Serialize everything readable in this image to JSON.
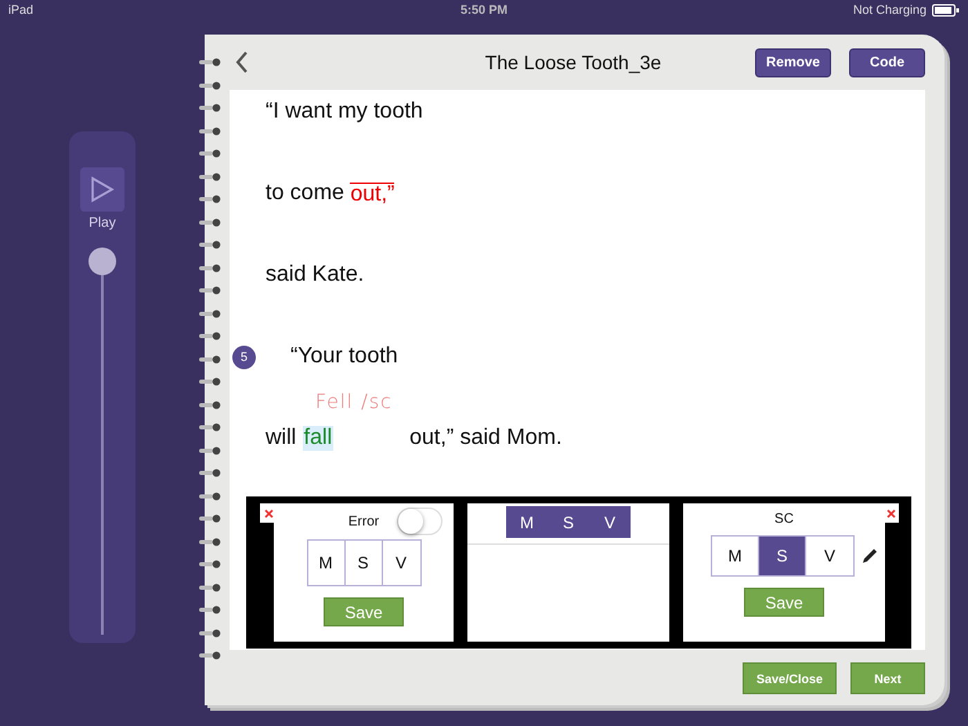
{
  "status_bar": {
    "device": "iPad",
    "time": "5:50 PM",
    "battery": "Not Charging"
  },
  "player": {
    "play_label": "Play",
    "slider": {
      "level": 1
    }
  },
  "header": {
    "title": "The Loose Tooth_3e",
    "buttons": [
      "Remove",
      "Code"
    ]
  },
  "story": [
    {
      "segments": [
        {
          "kind": "plain",
          "text": "“I want my tooth"
        }
      ]
    },
    {
      "segments": [
        {
          "kind": "plain",
          "text": "to come "
        },
        {
          "kind": "error",
          "text": "out,”"
        }
      ]
    },
    {
      "segments": [
        {
          "kind": "plain",
          "text": "said Kate."
        }
      ]
    },
    {
      "badge": "5",
      "segments": [
        {
          "kind": "plain",
          "text": "“Your tooth"
        }
      ]
    },
    {
      "segments": [
        {
          "kind": "plain",
          "text": "will "
        },
        {
          "kind": "self_corrected",
          "text": "fall",
          "note": "Fell /sc"
        },
        {
          "kind": "plain",
          "text": "out,” said Mom."
        }
      ]
    }
  ],
  "panels": [
    {
      "kind": "error",
      "label": "Error",
      "toggle_on": false,
      "cues": [
        {
          "text": "M",
          "selected": false
        },
        {
          "text": "S",
          "selected": false
        },
        {
          "text": "V",
          "selected": false
        }
      ],
      "save": "Save"
    },
    {
      "kind": "cues",
      "cues": [
        {
          "text": "M",
          "selected": true
        },
        {
          "text": "S",
          "selected": true
        },
        {
          "text": "V",
          "selected": true
        }
      ]
    },
    {
      "kind": "sc",
      "label": "SC",
      "cues": [
        {
          "text": "M",
          "selected": false
        },
        {
          "text": "S",
          "selected": true
        },
        {
          "text": "V",
          "selected": false
        }
      ],
      "save": "Save"
    }
  ],
  "footer": {
    "buttons": [
      "Save/Close",
      "Next"
    ]
  }
}
